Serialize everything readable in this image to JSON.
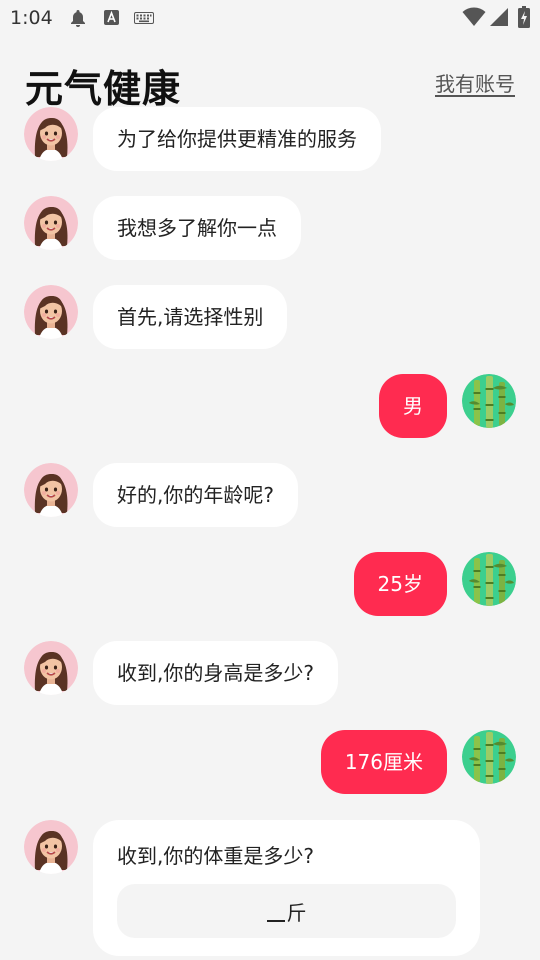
{
  "status": {
    "time": "1:04"
  },
  "header": {
    "title": "元气健康",
    "login_link": "我有账号"
  },
  "messages": [
    {
      "from": "assistant",
      "text": "为了给你提供更精准的服务"
    },
    {
      "from": "assistant",
      "text": "我想多了解你一点"
    },
    {
      "from": "assistant",
      "text": "首先,请选择性别"
    },
    {
      "from": "user",
      "text": "男"
    },
    {
      "from": "assistant",
      "text": "好的,你的年龄呢?"
    },
    {
      "from": "user",
      "text": "25岁"
    },
    {
      "from": "assistant",
      "text": "收到,你的身高是多少?"
    },
    {
      "from": "user",
      "text": "176厘米"
    }
  ],
  "weight_card": {
    "question": "收到,你的体重是多少?",
    "unit": "斤"
  },
  "colors": {
    "accent": "#ff2b50",
    "background": "#f4f4f4",
    "bubble": "#ffffff"
  }
}
